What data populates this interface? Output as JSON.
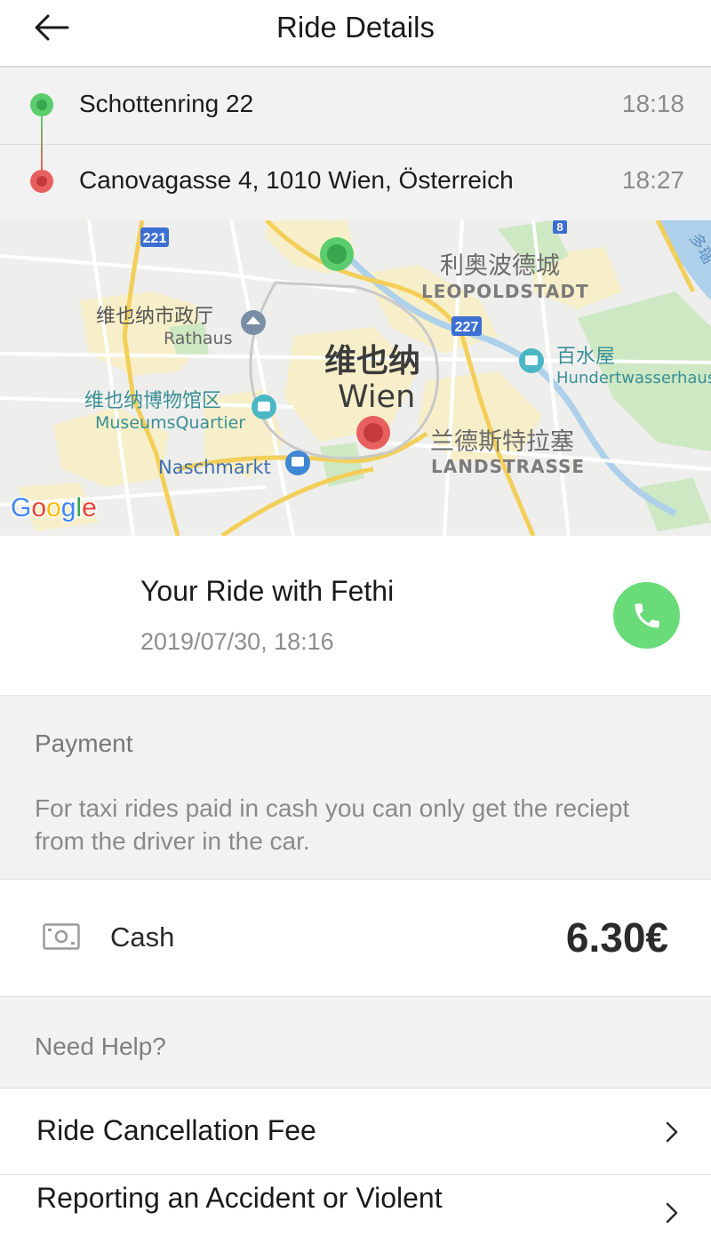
{
  "header": {
    "title": "Ride Details",
    "back_icon": "arrow-left-icon"
  },
  "route": {
    "pickup": {
      "address": "Schottenring 22",
      "time": "18:18",
      "color": "#5bcd6d"
    },
    "dropoff": {
      "address": "Canovagasse 4, 1010 Wien, Österreich",
      "time": "18:27",
      "color": "#e86060"
    }
  },
  "map": {
    "labels": {
      "route221": "221",
      "route227": "227",
      "route8": "8",
      "leopold_cn": "利奥波德城",
      "leopold": "LEOPOLDSTADT",
      "rathaus_cn": "维也纳市政厅",
      "rathaus": "Rathaus",
      "wien_cn": "维也纳",
      "wien": "Wien",
      "museum_cn": "维也纳博物馆区",
      "museum": "MuseumsQuartier",
      "hundert_cn": "百水屋",
      "hundert": "Hundertwasserhaus",
      "land_cn": "兰德斯特拉塞",
      "land": "LANDSTRASSE",
      "naschmarkt": "Naschmarkt",
      "river": "多瑙"
    },
    "google": [
      "G",
      "o",
      "o",
      "g",
      "l",
      "e"
    ]
  },
  "ride": {
    "title": "Your Ride with Fethi",
    "date": "2019/07/30, 18:16",
    "call_icon": "phone-icon",
    "call_color": "#6adb79"
  },
  "payment": {
    "label": "Payment",
    "note": "For taxi rides paid in cash you can only get the reciept from the driver in the car.",
    "method_icon": "cash-icon",
    "method": "Cash",
    "amount": "6.30€"
  },
  "help": {
    "label": "Need Help?",
    "items": [
      {
        "label": "Ride Cancellation Fee"
      },
      {
        "label": "Reporting an Accident or Violent"
      }
    ]
  }
}
